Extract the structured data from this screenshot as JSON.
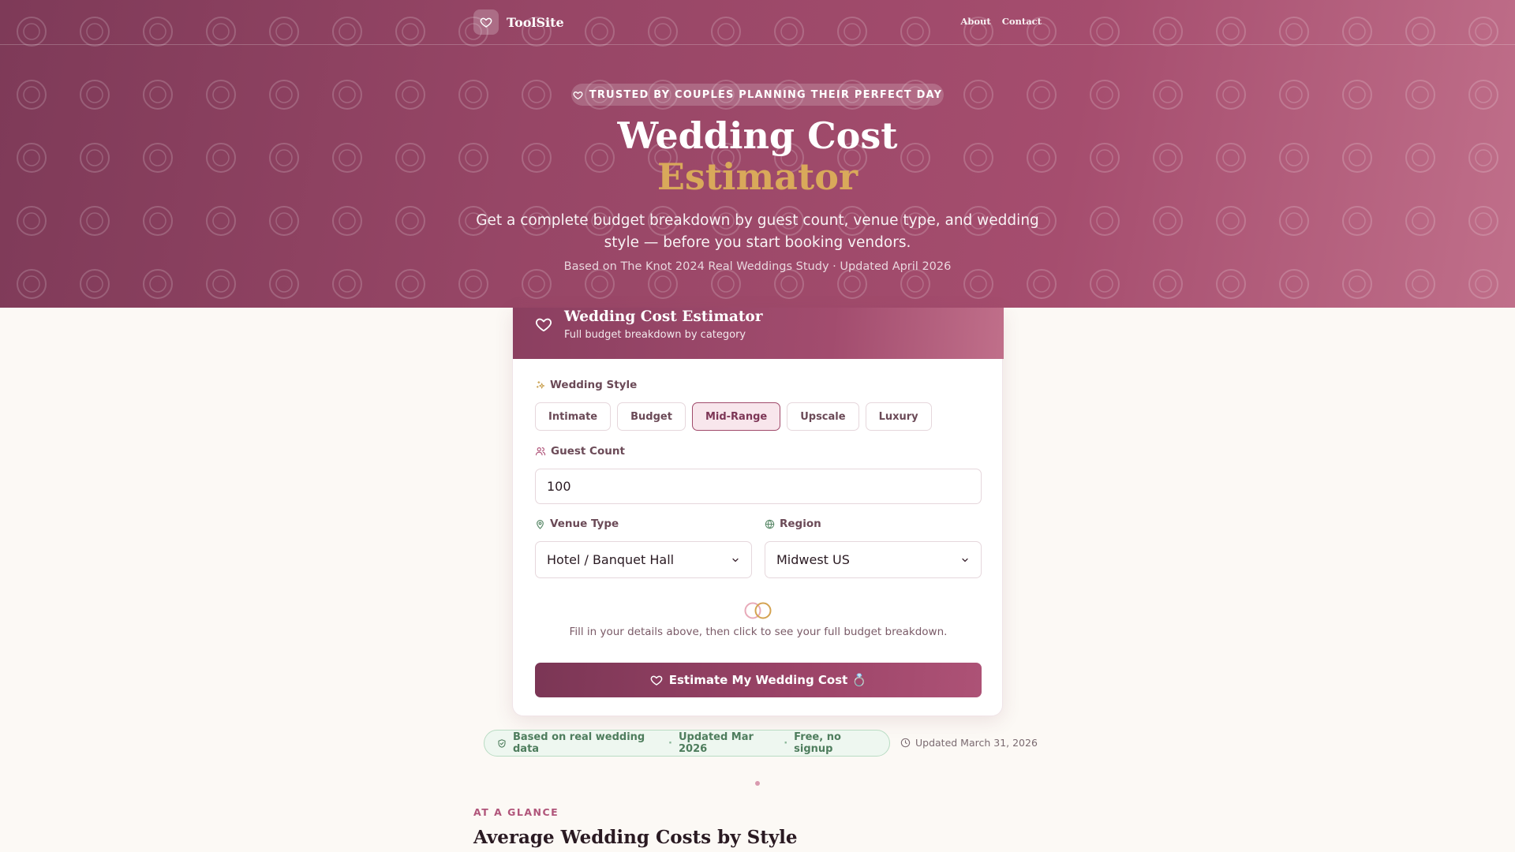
{
  "nav": {
    "brand": "ToolSite",
    "links": [
      "About",
      "Contact"
    ]
  },
  "hero": {
    "badge": "TRUSTED BY COUPLES PLANNING THEIR PERFECT DAY",
    "title_line1": "Wedding Cost",
    "title_line2": "Estimator",
    "subtitle": "Get a complete budget breakdown by guest count, venue type, and wedding style — before you start booking vendors.",
    "source": "Based on The Knot 2024 Real Weddings Study · Updated April 2026"
  },
  "card": {
    "title": "Wedding Cost Estimator",
    "subtitle": "Full budget breakdown by category",
    "style_label": "Wedding Style",
    "styles": [
      "Intimate",
      "Budget",
      "Mid-Range",
      "Upscale",
      "Luxury"
    ],
    "selected_style": "Mid-Range",
    "guest_label": "Guest Count",
    "guest_value": "100",
    "venue_label": "Venue Type",
    "venue_value": "Hotel / Banquet Hall",
    "region_label": "Region",
    "region_value": "Midwest US",
    "hint": "Fill in your details above, then click to see your full budget breakdown.",
    "cta": "Estimate My Wedding Cost 💍"
  },
  "badges": {
    "items": [
      "Based on real wedding data",
      "Updated Mar 2026",
      "Free, no signup"
    ],
    "updated": "Updated March 31, 2026"
  },
  "section": {
    "eyebrow": "AT A GLANCE",
    "title": "Average Wedding Costs by Style"
  },
  "colors": {
    "brand": "#974666",
    "accent_gold": "#d9a95a",
    "badge_green": "#4e7d5d",
    "page_bg": "#fcf9f5"
  }
}
